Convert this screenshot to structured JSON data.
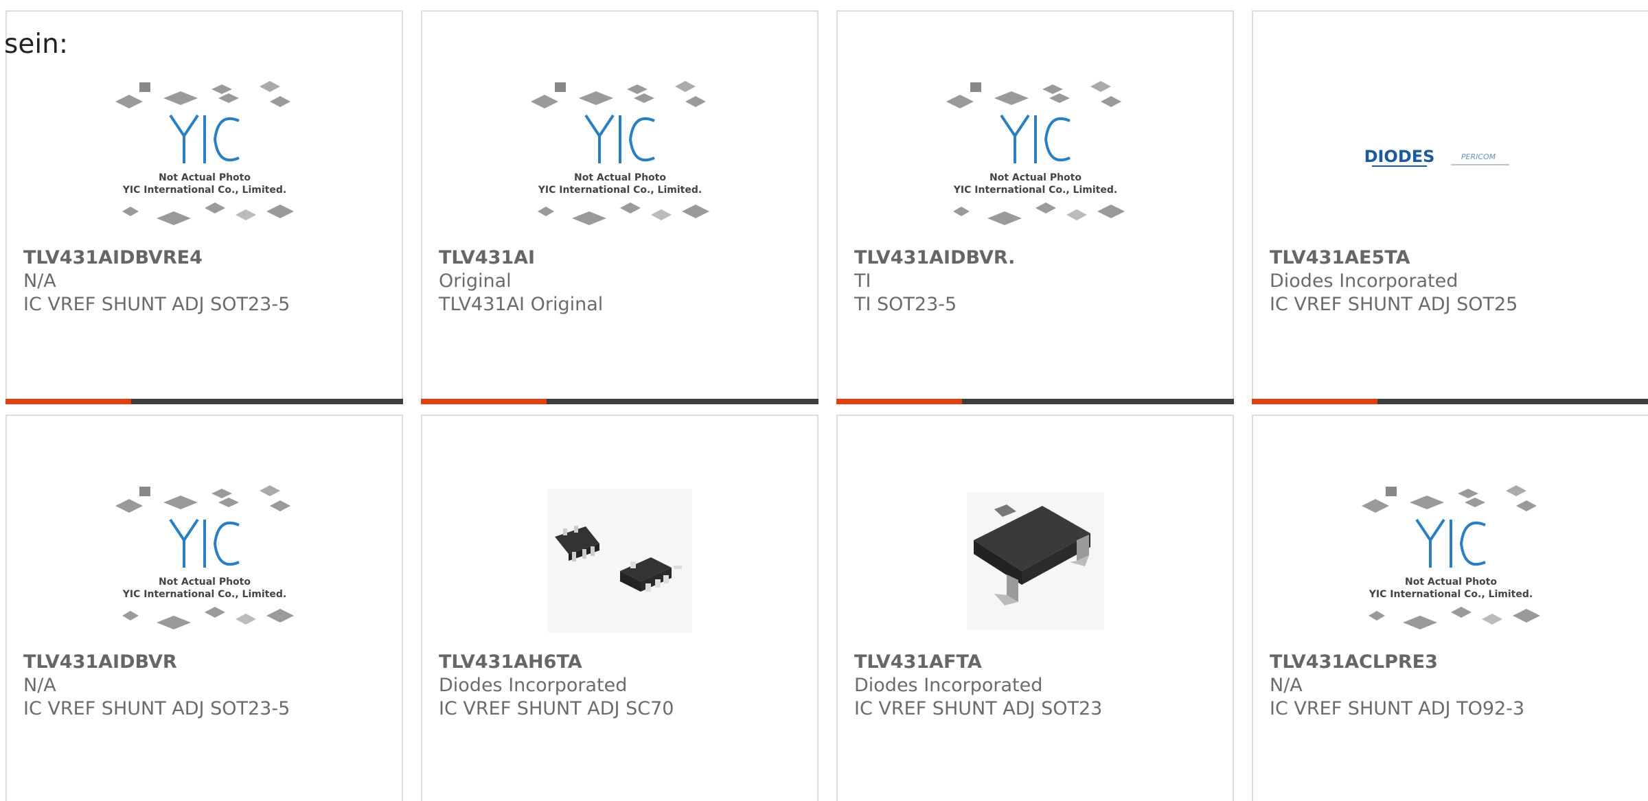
{
  "lead_text": "sein:",
  "colors": {
    "accent": "#e0400f",
    "bar": "#3d3d3d",
    "border": "#dddddd",
    "text": "#6b6b6b",
    "yic_blue": "#2a7fc0"
  },
  "placeholder": {
    "logo": "YIC",
    "line1": "Not Actual Photo",
    "line2": "YIC International Co., Limited."
  },
  "products": [
    {
      "part": "TLV431AIDBVRE4",
      "maker": "N/A",
      "desc": "IC VREF SHUNT ADJ SOT23-5",
      "image": "yic-placeholder-icon"
    },
    {
      "part": "TLV431AI",
      "maker": "Original",
      "desc": "TLV431AI Original",
      "image": "yic-placeholder-icon"
    },
    {
      "part": "TLV431AIDBVR.",
      "maker": "TI",
      "desc": "TI SOT23-5",
      "image": "yic-placeholder-icon"
    },
    {
      "part": "TLV431AE5TA",
      "maker": "Diodes Incorporated",
      "desc": "IC VREF SHUNT ADJ SOT25",
      "image": "diodes-pericom-logo"
    },
    {
      "part": "TLV431AIDBVR",
      "maker": "N/A",
      "desc": "IC VREF SHUNT ADJ SOT23-5",
      "image": "yic-placeholder-icon"
    },
    {
      "part": "TLV431AH6TA",
      "maker": "Diodes Incorporated",
      "desc": "IC VREF SHUNT ADJ SC70",
      "image": "sc70-chip-icon"
    },
    {
      "part": "TLV431AFTA",
      "maker": "Diodes Incorporated",
      "desc": "IC VREF SHUNT ADJ SOT23",
      "image": "sot23-chip-icon"
    },
    {
      "part": "TLV431ACLPRE3",
      "maker": "N/A",
      "desc": "IC VREF SHUNT ADJ TO92-3",
      "image": "yic-placeholder-icon"
    }
  ],
  "logos": {
    "diodes": "DIODES",
    "pericom": "PERICOM"
  }
}
